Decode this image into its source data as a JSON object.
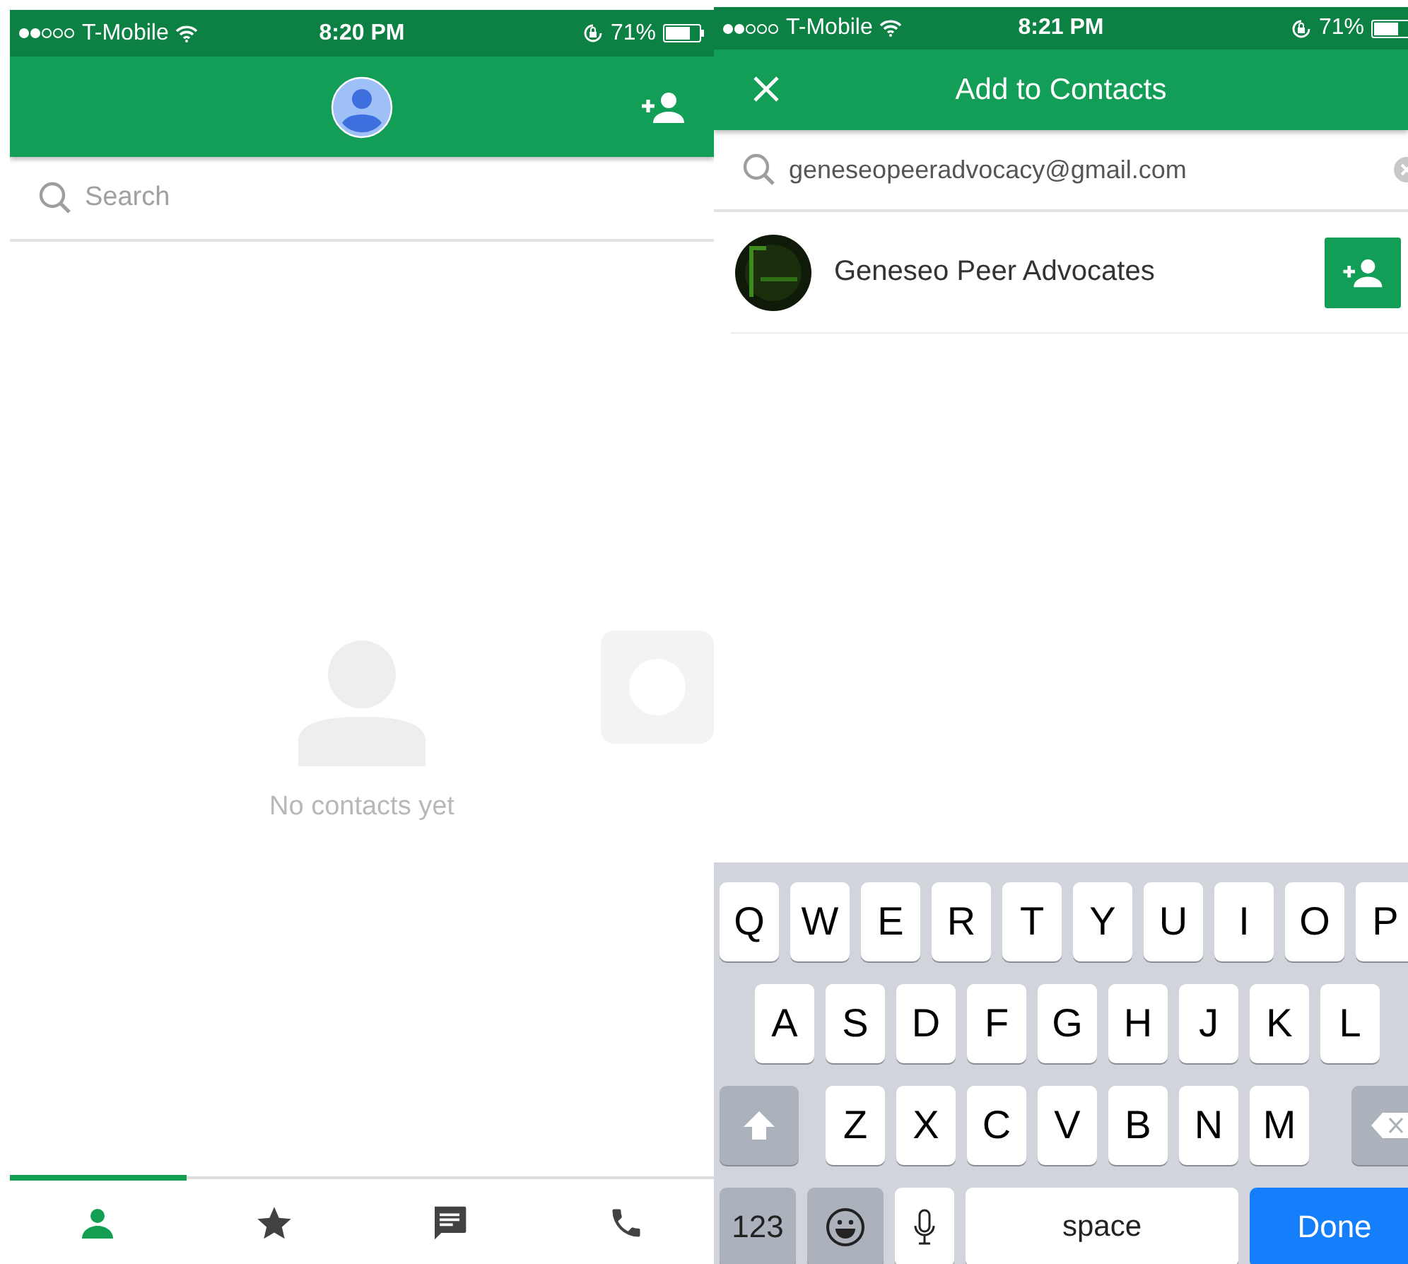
{
  "left_screen": {
    "status_bar": {
      "carrier": "T-Mobile",
      "time": "8:20 PM",
      "battery": "71%"
    },
    "search": {
      "placeholder": "Search"
    },
    "empty_state": {
      "message": "No contacts yet"
    },
    "tabs": [
      {
        "kind": "contacts",
        "selected": true
      },
      {
        "kind": "favorites",
        "selected": false
      },
      {
        "kind": "messages",
        "selected": false
      },
      {
        "kind": "calls",
        "selected": false
      }
    ]
  },
  "right_screen": {
    "status_bar": {
      "carrier": "T-Mobile",
      "time": "8:21 PM",
      "battery": "71%"
    },
    "title": "Add to Contacts",
    "search": {
      "value": "geneseopeeradvocacy@gmail.com"
    },
    "results": [
      {
        "name": "Geneseo Peer Advocates"
      }
    ],
    "keyboard": {
      "rows": [
        {
          "keys": [
            {
              "kind": "letter",
              "label": "Q"
            },
            {
              "kind": "letter",
              "label": "W"
            },
            {
              "kind": "letter",
              "label": "E"
            },
            {
              "kind": "letter",
              "label": "R"
            },
            {
              "kind": "letter",
              "label": "T"
            },
            {
              "kind": "letter",
              "label": "Y"
            },
            {
              "kind": "letter",
              "label": "U"
            },
            {
              "kind": "letter",
              "label": "I"
            },
            {
              "kind": "letter",
              "label": "O"
            },
            {
              "kind": "letter",
              "label": "P"
            }
          ]
        },
        {
          "keys": [
            {
              "kind": "letter",
              "label": "A"
            },
            {
              "kind": "letter",
              "label": "S"
            },
            {
              "kind": "letter",
              "label": "D"
            },
            {
              "kind": "letter",
              "label": "F"
            },
            {
              "kind": "letter",
              "label": "G"
            },
            {
              "kind": "letter",
              "label": "H"
            },
            {
              "kind": "letter",
              "label": "J"
            },
            {
              "kind": "letter",
              "label": "K"
            },
            {
              "kind": "letter",
              "label": "L"
            }
          ]
        },
        {
          "keys": [
            {
              "kind": "shift"
            },
            {
              "kind": "letter",
              "label": "Z"
            },
            {
              "kind": "letter",
              "label": "X"
            },
            {
              "kind": "letter",
              "label": "C"
            },
            {
              "kind": "letter",
              "label": "V"
            },
            {
              "kind": "letter",
              "label": "B"
            },
            {
              "kind": "letter",
              "label": "N"
            },
            {
              "kind": "letter",
              "label": "M"
            },
            {
              "kind": "backspace"
            }
          ]
        },
        {
          "keys": [
            {
              "kind": "numbers",
              "label": "123"
            },
            {
              "kind": "emoji"
            },
            {
              "kind": "mic"
            },
            {
              "kind": "space",
              "label": "space"
            },
            {
              "kind": "done",
              "label": "Done"
            }
          ]
        }
      ]
    }
  }
}
